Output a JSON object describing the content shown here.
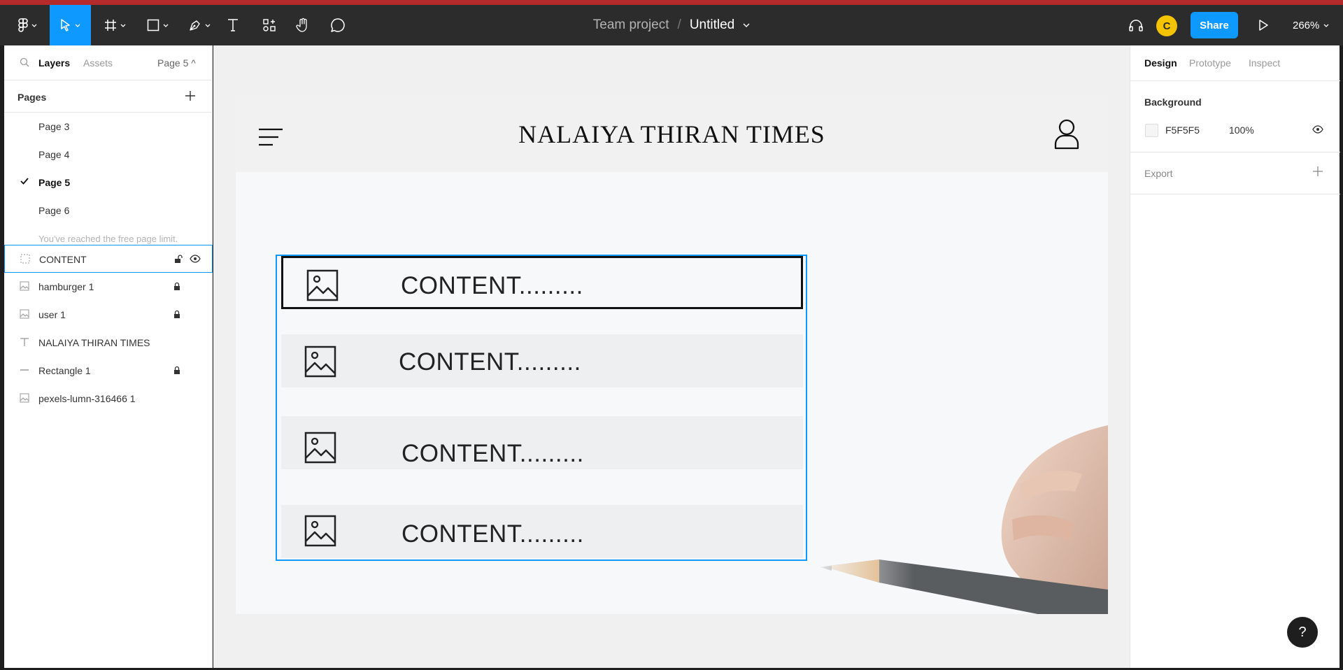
{
  "toolbar": {
    "team_project": "Team project",
    "separator": "/",
    "file_title": "Untitled",
    "avatar_letter": "C",
    "share_label": "Share",
    "zoom": "266%"
  },
  "left_panel": {
    "tabs": {
      "layers": "Layers",
      "assets": "Assets",
      "page_selector": "Page 5 ^"
    },
    "pages_title": "Pages",
    "pages": [
      {
        "label": "Page 3"
      },
      {
        "label": "Page 4"
      },
      {
        "label": "Page 5",
        "selected": true
      },
      {
        "label": "Page 6"
      }
    ],
    "page_limit_note": "You've reached the free page limit.",
    "layers": [
      {
        "label": "CONTENT",
        "icon": "frame-icon",
        "selected": true
      },
      {
        "label": "hamburger 1",
        "icon": "image-icon",
        "locked": true
      },
      {
        "label": "user 1",
        "icon": "image-icon",
        "locked": true
      },
      {
        "label": "NALAIYA THIRAN TIMES",
        "icon": "text-icon"
      },
      {
        "label": "Rectangle 1",
        "icon": "line-icon",
        "locked": true
      },
      {
        "label": "pexels-lumn-316466 1",
        "icon": "image-icon"
      }
    ]
  },
  "canvas": {
    "brand_title": "NALAIYA THIRAN TIMES",
    "cards": [
      {
        "text": "CONTENT........."
      },
      {
        "text": "CONTENT........."
      },
      {
        "text": "CONTENT........."
      },
      {
        "text": "CONTENT........."
      }
    ]
  },
  "right_panel": {
    "tabs": {
      "design": "Design",
      "prototype": "Prototype",
      "inspect": "Inspect"
    },
    "background_title": "Background",
    "background_hex": "F5F5F5",
    "background_opacity": "100%",
    "export_title": "Export"
  },
  "help_label": "?",
  "colors": {
    "accent": "#0d99ff",
    "toolbar": "#2c2c2c",
    "avatar": "#f5c400",
    "background": "#F5F5F5"
  }
}
